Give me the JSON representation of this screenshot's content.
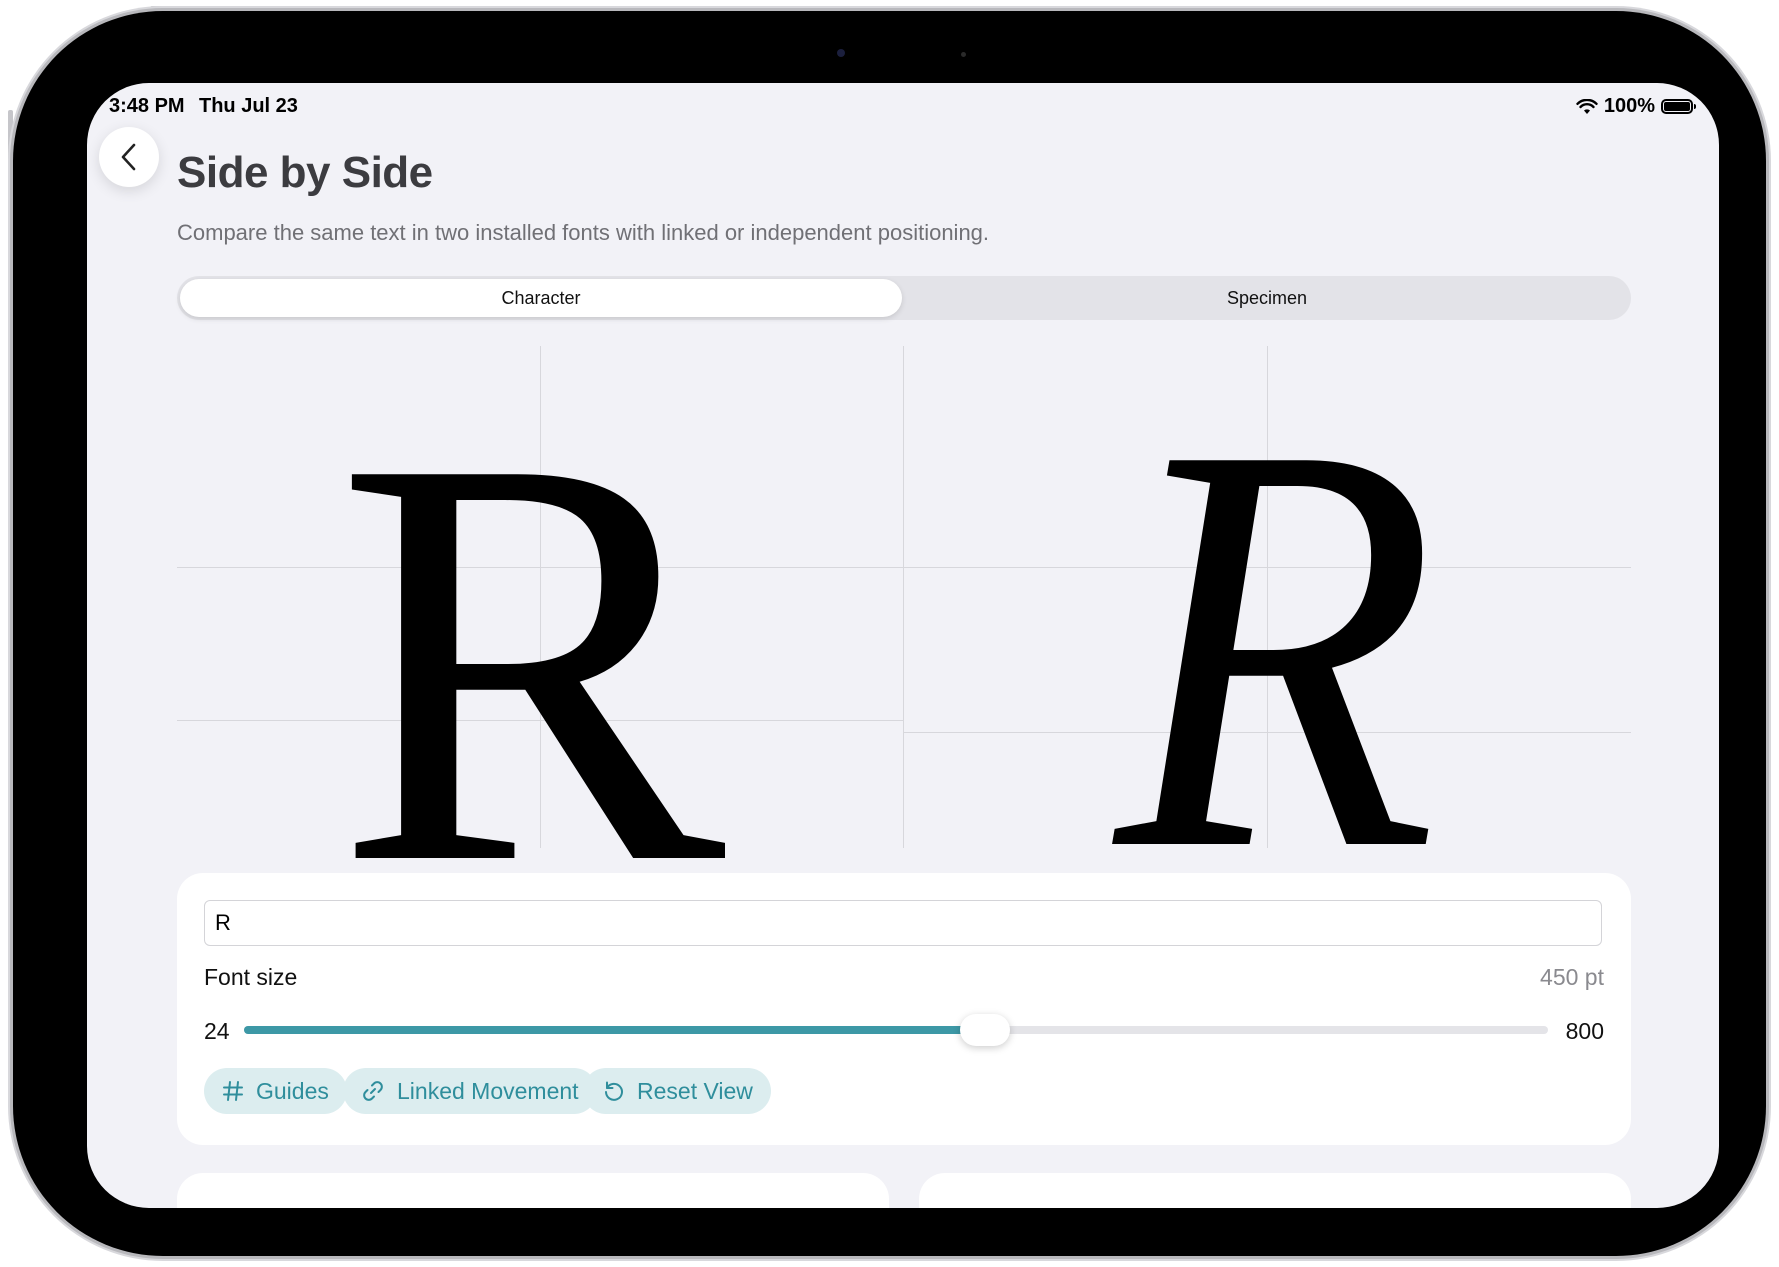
{
  "status_bar": {
    "time": "3:48 PM",
    "date": "Thu Jul 23",
    "battery": "100%"
  },
  "page": {
    "title": "Side by Side",
    "subtitle": "Compare the same text in two installed fonts with linked or independent positioning."
  },
  "tabs": [
    {
      "label": "Character",
      "selected": true
    },
    {
      "label": "Specimen",
      "selected": false
    }
  ],
  "preview": {
    "left_glyph": "R",
    "right_glyph": "R"
  },
  "controls": {
    "text_value": "R",
    "font_size_label": "Font size",
    "font_size_value": "450 pt",
    "slider_min": "24",
    "slider_max": "800",
    "slider_fraction": 0.549,
    "buttons": [
      {
        "label": "Guides",
        "icon": "hash-icon"
      },
      {
        "label": "Linked Movement",
        "icon": "link-icon"
      },
      {
        "label": "Reset View",
        "icon": "reset-icon"
      }
    ]
  },
  "colors": {
    "accent": "#3d98a6",
    "pill_bg": "#dcedef",
    "background": "#f2f2f7"
  }
}
